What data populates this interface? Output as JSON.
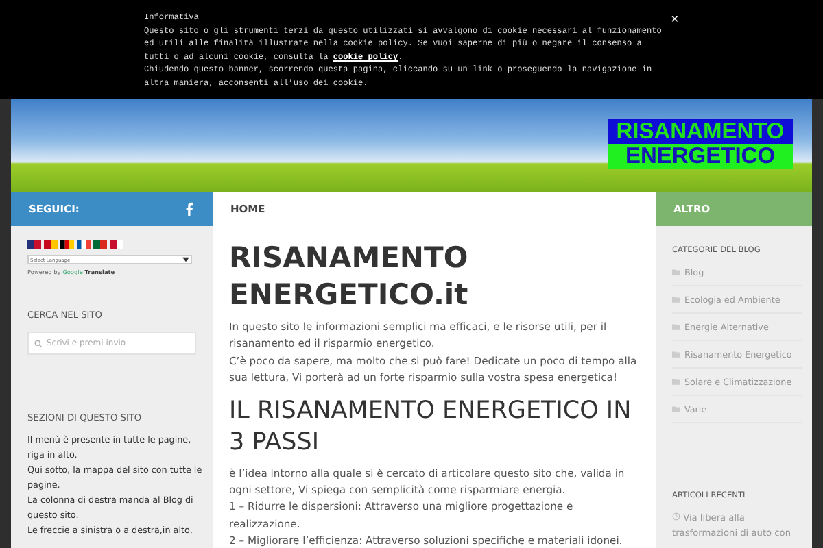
{
  "cookie_banner": {
    "title": "Informativa",
    "line_1": "Questo sito o gli strumenti terzi da questo utilizzati si avvalgono di cookie necessari al funzionamento ed utili alle finalità illustrate nella cookie policy. Se vuoi saperne di più o negare il consenso a tutti o ad alcuni cookie, consulta la",
    "link": "cookie policy",
    "after_link": ".",
    "line_2": "Chiudendo questo banner, scorrendo questa pagina, cliccando su un link o proseguendo la navigazione in altra maniera, acconsenti all’uso dei cookie.",
    "close": "×"
  },
  "header": {
    "logo_lines": [
      "RISANAMENTO",
      "ENERGETICO"
    ]
  },
  "nav": {
    "left_label": "SEGUICI:",
    "menu": [
      {
        "label": "HOME",
        "selected": false
      }
    ],
    "right_label": "ALTRO"
  },
  "left_sidebar": {
    "translate": {
      "select": "Select Language",
      "powered_by": "Powered by",
      "google": "Google",
      "translate": "Translate"
    },
    "search": {
      "title": "CERCA NEL SITO",
      "placeholder": "Scrivi e premi invio"
    },
    "sections": {
      "title": "SEZIONI DI QUESTO SITO",
      "paragraphs": [
        "Il menù è presente in tutte le pagine, riga in alto.",
        "Qui sotto, la mappa del sito con tutte le pagine.",
        "La colonna di destra manda al Blog di questo sito.",
        "Le freccie a sinistra o a destra,in alto,"
      ]
    }
  },
  "main": {
    "title": "RISANAMENTO ENERGETICO.it",
    "intro": [
      "In questo sito le informazioni semplici ma efficaci, e le risorse utili, per il risanamento ed il risparmio energetico.",
      "C’è poco da sapere, ma molto che si può fare! Dedicate un poco di tempo alla sua lettura, Vi porterà ad un forte risparmio sulla vostra spesa energetica!"
    ],
    "heading": "IL RISANAMENTO ENERGETICO IN  3 PASSI",
    "body": [
      "è l’idea intorno alla quale si è cercato di articolare questo sito che, valida in ogni settore, Vi spiega con semplicità come risparmiare energia.",
      "1 – Ridurre le dispersioni: Attraverso una migliore progettazione e realizzazione.",
      "2 – Migliorare l’efficienza: Attraverso soluzioni specifiche e materiali idonei."
    ]
  },
  "right_sidebar": {
    "categories": {
      "title": "CATEGORIE DEL BLOG",
      "items": [
        "Blog",
        "Ecologia ed Ambiente",
        "Energie Alternative",
        "Risanamento Energetico",
        "Solare e Climatizzazione",
        "Varie"
      ]
    },
    "recent": {
      "title": "ARTICOLI RECENTI",
      "items": [
        "Via libera alla trasformazioni di auto con"
      ]
    }
  }
}
